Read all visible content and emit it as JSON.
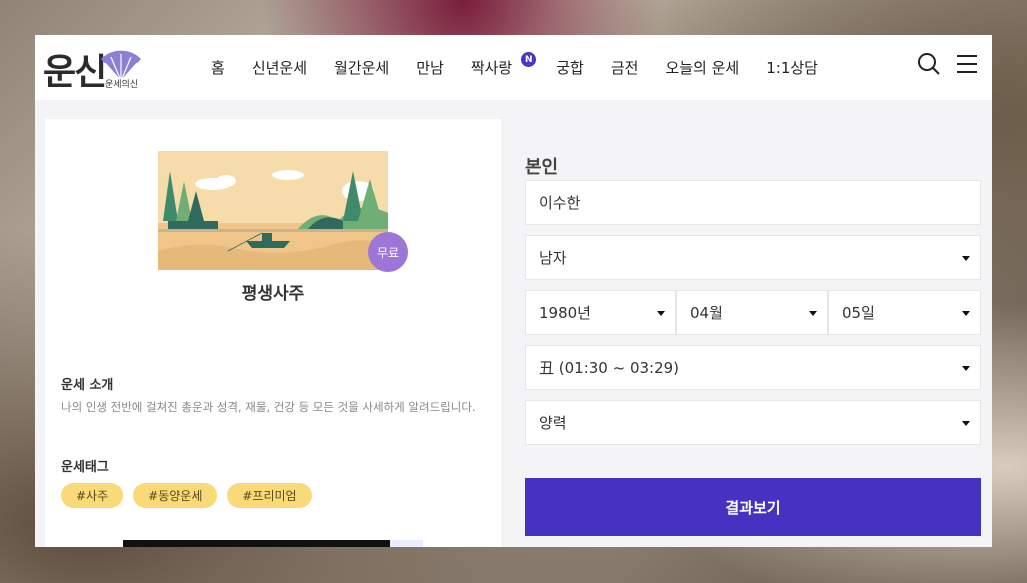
{
  "brand": {
    "logo_main": "운신",
    "logo_sub": "운세의신"
  },
  "nav": {
    "items": [
      {
        "label": "홈"
      },
      {
        "label": "신년운세"
      },
      {
        "label": "월간운세"
      },
      {
        "label": "만남"
      },
      {
        "label": "짝사랑",
        "badge": "N"
      },
      {
        "label": "궁합"
      },
      {
        "label": "금전"
      },
      {
        "label": "오늘의 운세"
      },
      {
        "label": "1:1상담"
      }
    ],
    "search_icon": "search-icon",
    "menu_icon": "hamburger-menu-icon"
  },
  "product": {
    "badge": "무료",
    "title": "평생사주",
    "intro_title": "운세 소개",
    "intro_desc": "나의 인생 전반에 걸쳐진 총운과 성격, 재물, 건강 등 모든 것을 사세하게 알려드립니다.",
    "tags_title": "운세태그",
    "tags": [
      "#사주",
      "#동양운세",
      "#프리미엄"
    ]
  },
  "form": {
    "label": "본인",
    "name_value": "이수한",
    "gender": "남자",
    "year": "1980년",
    "month": "04월",
    "day": "05일",
    "birth_time": "丑 (01:30 ~ 03:29)",
    "calendar": "양력",
    "submit_label": "결과보기"
  },
  "colors": {
    "accent": "#4632c2",
    "badge": "#9c77d9",
    "tag": "#f9d978",
    "new_badge": "#4b36c1"
  }
}
